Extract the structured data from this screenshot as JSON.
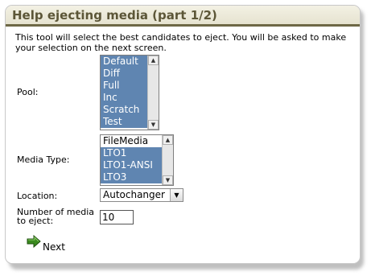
{
  "title": "Help ejecting media (part 1/2)",
  "intro": "This tool will select the best candidates to eject. You will be asked to make your selection on the next screen.",
  "pool": {
    "label": "Pool:",
    "options": [
      "Default",
      "Diff",
      "Full",
      "Inc",
      "Scratch",
      "Test"
    ]
  },
  "media_type": {
    "label": "Media Type:",
    "options": [
      "FileMedia",
      "LTO1",
      "LTO1-ANSI",
      "LTO3"
    ]
  },
  "location": {
    "label": "Location:",
    "selected": "Autochanger"
  },
  "number": {
    "label_line1": "Number of media",
    "label_line2": "to eject:",
    "value": "10"
  },
  "next_label": "Next",
  "colors": {
    "title_text": "#5c5637",
    "title_border": "#6e6846",
    "selection": "#5f85b1",
    "next_arrow": "#3a8a1e"
  }
}
